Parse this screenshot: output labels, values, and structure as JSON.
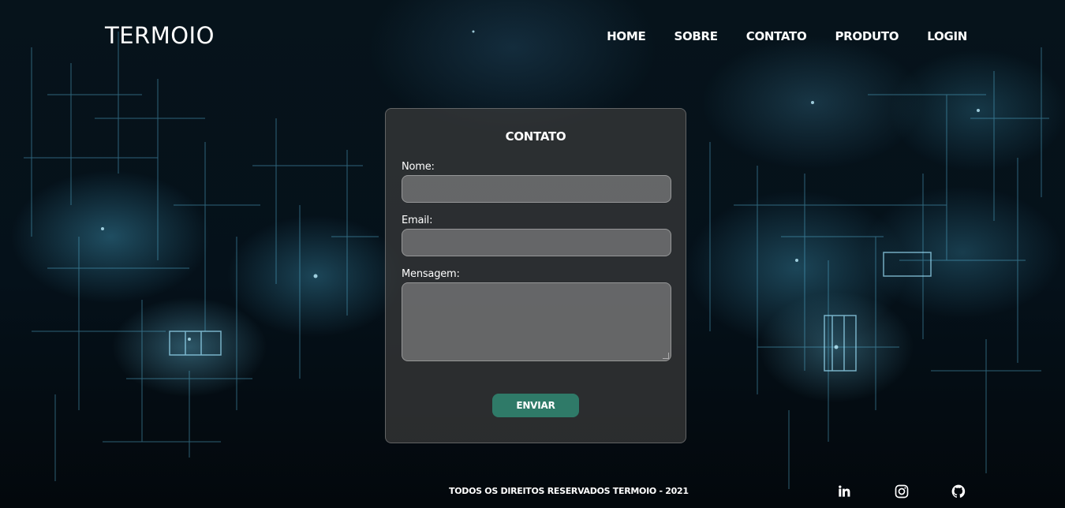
{
  "header": {
    "logo": "TERMOIO",
    "nav": [
      "HOME",
      "SOBRE",
      "CONTATO",
      "PRODUTO",
      "LOGIN"
    ]
  },
  "form": {
    "title": "CONTATO",
    "fields": {
      "name_label": "Nome:",
      "email_label": "Email:",
      "message_label": "Mensagem:"
    },
    "submit_label": "ENVIAR"
  },
  "footer": {
    "copyright": "TODOS OS DIREITOS RESERVADOS TERMOIO - 2021",
    "social_icons": [
      "linkedin-icon",
      "instagram-icon",
      "github-icon"
    ]
  },
  "colors": {
    "background": "#05111a",
    "accent": "#2f7a68",
    "glow": "#50bee6"
  }
}
